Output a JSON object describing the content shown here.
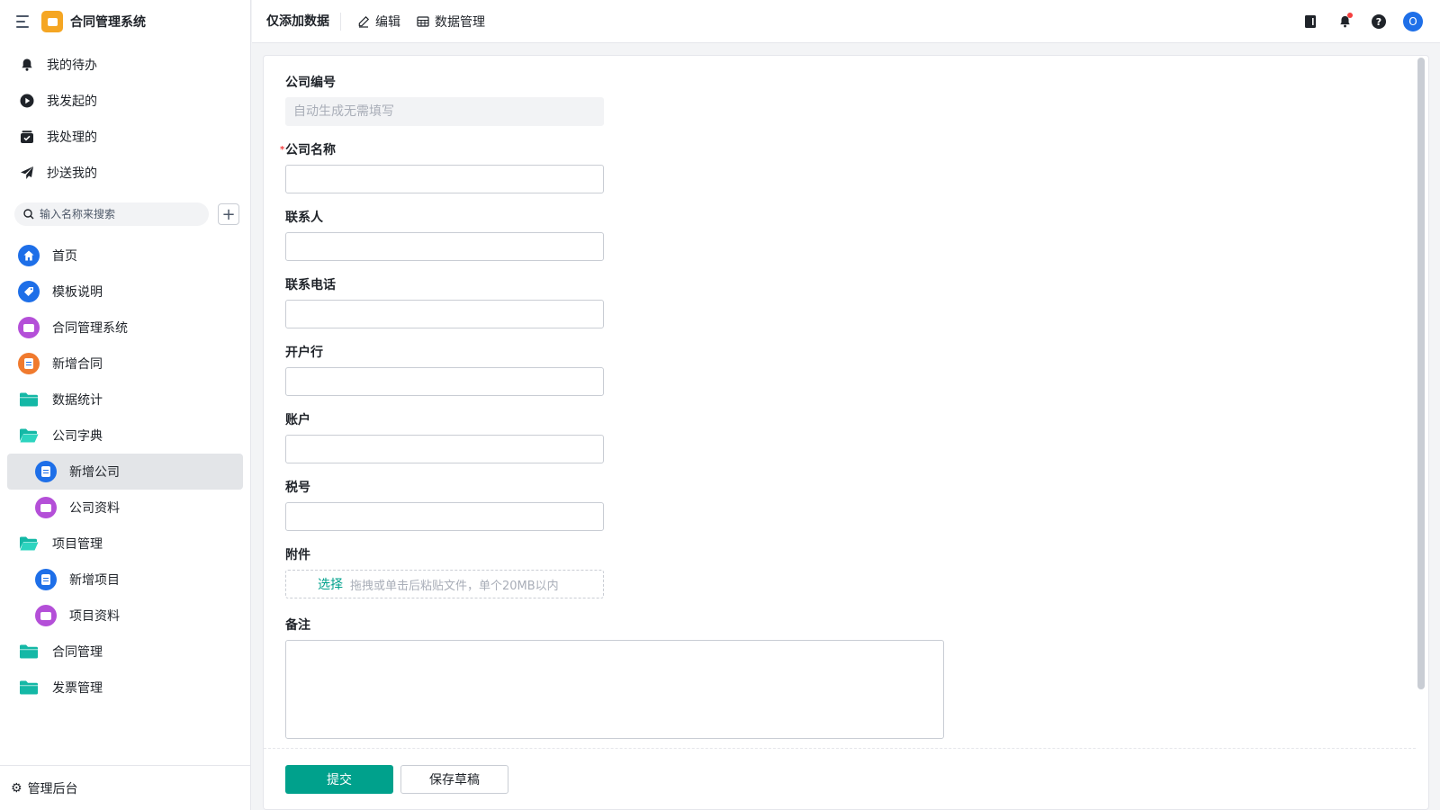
{
  "app": {
    "title": "合同管理系统"
  },
  "quick_menu": [
    {
      "label": "我的待办",
      "icon": "bell-icon"
    },
    {
      "label": "我发起的",
      "icon": "play-circle-icon"
    },
    {
      "label": "我处理的",
      "icon": "check-box-icon"
    },
    {
      "label": "抄送我的",
      "icon": "send-icon"
    }
  ],
  "search": {
    "placeholder": "输入名称来搜索"
  },
  "nav": [
    {
      "label": "首页",
      "icon": "home-icon",
      "level": 1
    },
    {
      "label": "模板说明",
      "icon": "tag-icon",
      "level": 1
    },
    {
      "label": "合同管理系统",
      "icon": "dashboard-icon",
      "level": 1
    },
    {
      "label": "新增合同",
      "icon": "form-icon",
      "level": 1
    },
    {
      "label": "数据统计",
      "icon": "folder-icon",
      "level": 1
    },
    {
      "label": "公司字典",
      "icon": "folder-open-icon",
      "level": 1
    },
    {
      "label": "新增公司",
      "icon": "form-icon",
      "level": 2,
      "active": true
    },
    {
      "label": "公司资料",
      "icon": "dashboard-icon",
      "level": 2
    },
    {
      "label": "项目管理",
      "icon": "folder-open-icon",
      "level": 1
    },
    {
      "label": "新增项目",
      "icon": "form-icon",
      "level": 2
    },
    {
      "label": "项目资料",
      "icon": "dashboard-icon",
      "level": 2
    },
    {
      "label": "合同管理",
      "icon": "folder-icon",
      "level": 1
    },
    {
      "label": "发票管理",
      "icon": "folder-icon",
      "level": 1
    }
  ],
  "footer": {
    "label": "管理后台"
  },
  "topbar": {
    "title": "仅添加数据",
    "edit_label": "编辑",
    "data_label": "数据管理",
    "avatar_letter": "O"
  },
  "form": {
    "company_no": {
      "label": "公司编号",
      "placeholder": "自动生成无需填写"
    },
    "company_name": {
      "label": "公司名称",
      "required_mark": "*"
    },
    "contact": {
      "label": "联系人"
    },
    "phone": {
      "label": "联系电话"
    },
    "bank": {
      "label": "开户行"
    },
    "account": {
      "label": "账户"
    },
    "tax_no": {
      "label": "税号"
    },
    "attachment": {
      "label": "附件",
      "pick": "选择",
      "hint": "拖拽或单击后粘贴文件，单个20MB以内"
    },
    "remark": {
      "label": "备注"
    }
  },
  "actions": {
    "submit": "提交",
    "draft": "保存草稿"
  },
  "colors": {
    "primary": "#00a18c",
    "accent_blue": "#1e6fe8",
    "purple": "#b44fd8",
    "orange": "#f07a2e",
    "folder": "#14b8a6"
  }
}
